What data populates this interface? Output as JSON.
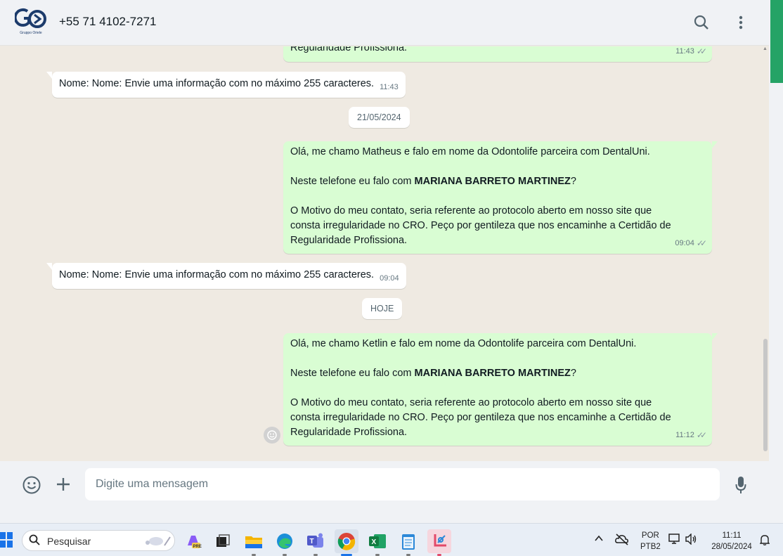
{
  "header": {
    "avatar_logo": "GO",
    "avatar_sub": "Gruppo Oriele",
    "contact": "+55 71 4102-7271",
    "icons": [
      "search-icon",
      "menu-dots-icon"
    ]
  },
  "messages": {
    "m0": {
      "lines": "Regularidade Profissiona.",
      "time": "11:43"
    },
    "m1": {
      "text": "Nome: Nome: Envie uma informação com no máximo 255 caracteres.",
      "time": "11:43"
    },
    "d1": "21/05/2024",
    "m2": {
      "line1": "Olá, me chamo Matheus e falo em nome da Odontolife parceira com DentalUni.",
      "line2_pre": "Neste telefone eu falo com ",
      "line2_bold": "MARIANA BARRETO MARTINEZ",
      "line2_post": "?",
      "line3": "O Motivo do meu contato, seria referente ao protocolo aberto em nosso site que\nconsta irregularidade no CRO. Peço por gentileza que nos encaminhe a Certidão de\nRegularidade Profissiona.",
      "time": "09:04"
    },
    "m3": {
      "text": "Nome: Nome: Envie uma informação com no máximo 255 caracteres.",
      "time": "09:04"
    },
    "d2": "HOJE",
    "m4": {
      "line1": "Olá, me chamo Ketlin e falo em nome da Odontolife parceira com DentalUni.",
      "line2_pre": "Neste telefone eu falo com ",
      "line2_bold": "MARIANA BARRETO MARTINEZ",
      "line2_post": "?",
      "line3": "O Motivo do meu contato, seria referente ao protocolo aberto em nosso site que\nconsta irregularidade no CRO. Peço por gentileza que nos encaminhe a Certidão de\nRegularidade Profissiona.",
      "time": "11:12"
    },
    "ticks": "✓✓"
  },
  "composer": {
    "placeholder": "Digite uma mensagem"
  },
  "taskbar": {
    "search_label": "Pesquisar",
    "apps": [
      "copilot",
      "task-view",
      "file-explorer",
      "edge",
      "teams",
      "chrome",
      "excel",
      "notepad",
      "snipping-tool"
    ],
    "lang_top": "POR",
    "lang_bottom": "PTB2",
    "time": "11:11",
    "date": "28/05/2024"
  },
  "colors": {
    "outgoing_bubble": "#d9fdd3",
    "incoming_bubble": "#ffffff",
    "chat_bg": "#efeae2",
    "accent_green": "#25a366"
  }
}
